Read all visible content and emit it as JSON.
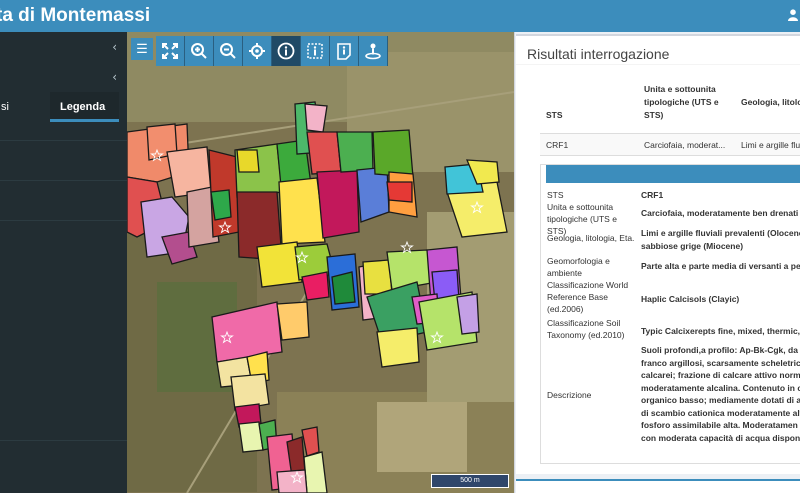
{
  "header": {
    "title": "ta di Montemassi"
  },
  "sidebar": {
    "tab_left_label": "si",
    "tab_legenda_label": "Legenda"
  },
  "map": {
    "scale_label": "500 m",
    "tools": [
      "zoom-extent-icon",
      "zoom-in-icon",
      "zoom-out-icon",
      "zoom-to-selection-icon",
      "info-icon",
      "info-box-icon",
      "info-doc-icon",
      "locate-icon"
    ]
  },
  "results": {
    "title": "Risultati interrogazione",
    "columns": {
      "sts": "STS",
      "uts": "Unita e sottounita tipologiche (UTS e STS)",
      "geo": "Geologia, litolo Eta."
    },
    "row": {
      "sts": "CRF1",
      "uts": "Carciofaia, moderat...",
      "geo": "Limi e argille flu"
    },
    "detail": {
      "sts_label": "STS",
      "sts_value": "CRF1",
      "uts_label": "Unita e sottounita tipologiche (UTS e STS)",
      "uts_value": "Carciofaia, moderatamente ben drenati",
      "geo_label": "Geologia, litologia, Eta.",
      "geo_value_1": "Limi e argille fluviali prevalenti (Olocene",
      "geo_value_2": "sabbiose grige (Miocene)",
      "geom_label": "Geomorfologia e ambiente",
      "geom_value": "Parte alta e parte media di versanti a pen",
      "wrb_label": "Classificazione World Reference Base (ed.2006)",
      "wrb_value": "Haplic Calcisols (Clayic)",
      "st_label": "Classificazione Soil Taxonomy (ed.2010)",
      "st_value": "Typic Calcixerepts fine, mixed, thermic,",
      "desc_label": "Descrizione",
      "desc_lines": [
        "Suoli profondi,a profilo: Ap-Bk-Cgk, da a",
        "franco argillosi, scarsamente scheletrici",
        "calcarei; frazione di calcare attivo norma",
        "moderatamente alcalina. Contenuto in c",
        "organico basso; mediamente dotati di az",
        "di scambio cationica moderatamente alt",
        "fosforo assimilabile alta. Moderatamen",
        "con moderata capacità di acqua disponib"
      ]
    }
  }
}
